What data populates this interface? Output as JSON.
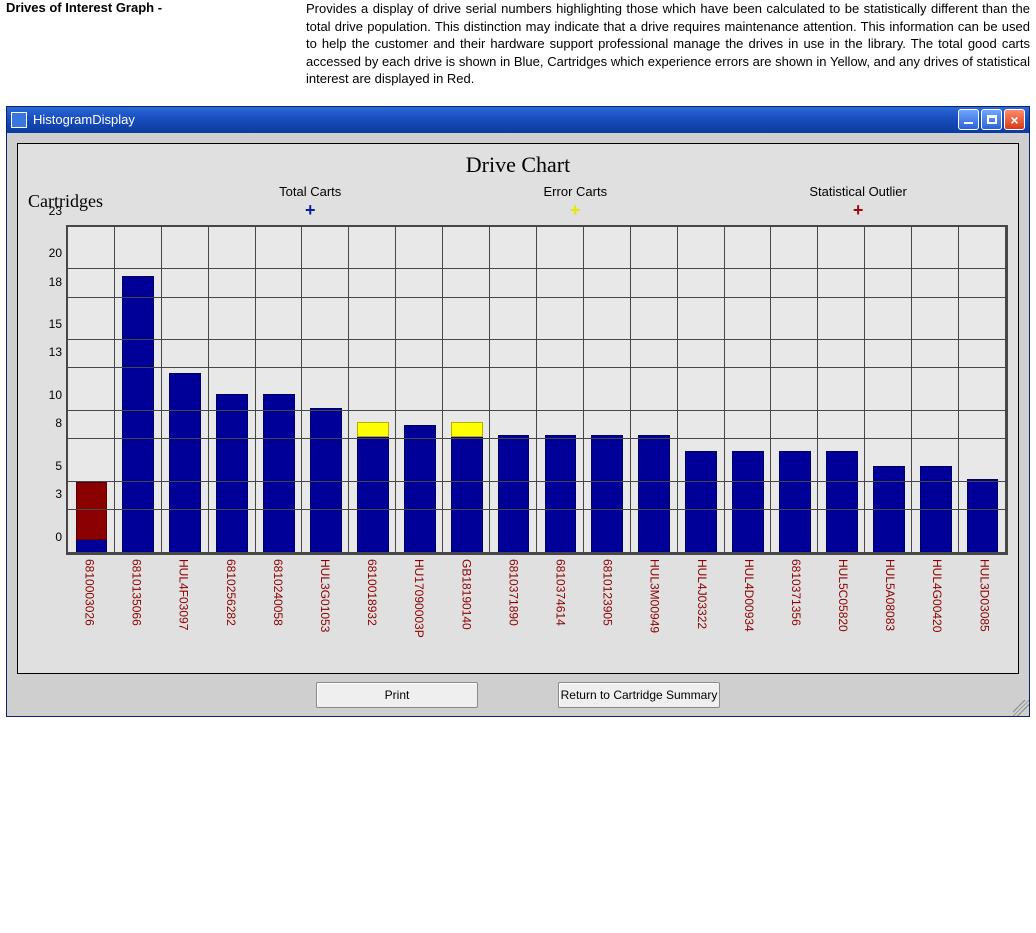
{
  "intro": {
    "label": "Drives of Interest Graph -",
    "text": "Provides a display of drive serial numbers highlighting those which have been calculated to be statistically different than the total drive population.  This distinction may indicate that a drive requires maintenance attention.  This information can be used to help the customer and their hardware support professional manage the drives in use in the library.  The total good carts accessed by each drive is shown in Blue, Cartridges which experience errors are shown in Yellow, and any drives of statistical interest are displayed in Red."
  },
  "window": {
    "title": "HistogramDisplay"
  },
  "buttons": {
    "print": "Print",
    "return": "Return to Cartridge Summary"
  },
  "legend": {
    "ylabel": "Cartridges",
    "items": [
      {
        "label": "Total Carts",
        "color": "blue"
      },
      {
        "label": "Error Carts",
        "color": "yellow"
      },
      {
        "label": "Statistical Outlier",
        "color": "red"
      }
    ]
  },
  "chart_data": {
    "type": "bar",
    "title": "Drive Chart",
    "ylabel": "Cartridges",
    "xlabel": "",
    "ylim": [
      0,
      23
    ],
    "yticks": [
      0,
      3,
      5,
      8,
      10,
      13,
      15,
      18,
      20,
      23
    ],
    "categories": [
      "6810003026",
      "6810135066",
      "HUL4F03097",
      "6810256282",
      "6810240058",
      "HUL3G01053",
      "6810018932",
      "HU17090003P",
      "GB18190140",
      "6810371890",
      "6810374614",
      "6810123905",
      "HUL3M00949",
      "HUL4J03322",
      "HUL4D00934",
      "6810371356",
      "HUL5C05820",
      "HUL5A08083",
      "HUL4G00420",
      "HUL3D03085"
    ],
    "series": [
      {
        "name": "Total Carts",
        "color": "blue",
        "values": [
          5.0,
          19.5,
          12.7,
          11.2,
          11.2,
          10.2,
          9.2,
          9.0,
          9.2,
          8.3,
          8.3,
          8.3,
          8.3,
          7.2,
          7.2,
          7.2,
          7.2,
          6.1,
          6.1,
          5.2
        ]
      },
      {
        "name": "Error Carts",
        "color": "yellow",
        "values": [
          0,
          0,
          0,
          0,
          0,
          0,
          1.0,
          0,
          1.0,
          0,
          0,
          0,
          0,
          0,
          0,
          0,
          0,
          0,
          0,
          0
        ]
      },
      {
        "name": "Statistical Outlier",
        "color": "red",
        "values": [
          5.0,
          0,
          0,
          0,
          0,
          0,
          0,
          0,
          0,
          0,
          0,
          0,
          0,
          0,
          0,
          0,
          0,
          0,
          0,
          0
        ]
      }
    ],
    "stacked_hint": "For each category total bar height = Total Carts; Error (yellow) and Outlier (red) overlay the top portion; remaining lower portion is blue."
  }
}
